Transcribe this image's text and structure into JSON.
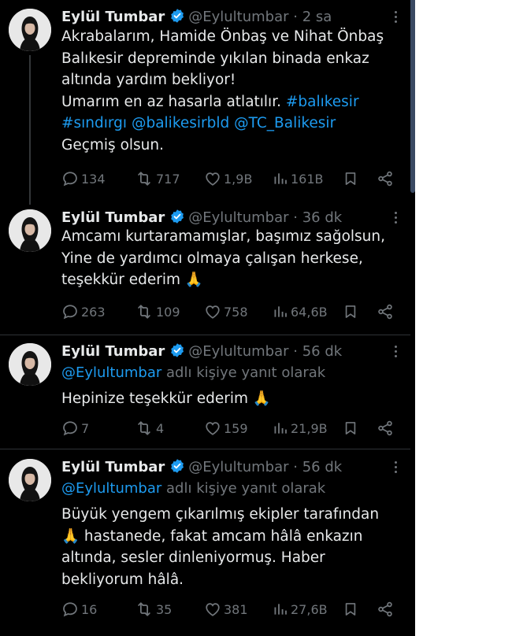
{
  "colors": {
    "background": "#000000",
    "text": "#e7e9ea",
    "secondary": "#71767b",
    "link": "#1d9bf0",
    "verified": "#1d9bf0",
    "divider": "#2f3336"
  },
  "tweets": [
    {
      "name": "Eylül Tumbar",
      "handle": "@Eylultumbar",
      "time": "· 2 sa",
      "reply_to": null,
      "lines": [
        [
          {
            "t": "Akrabalarım, Hamide Önbaş ve Nihat Önbaş"
          }
        ],
        [
          {
            "t": "Balıkesir depreminde yıkılan binada enkaz"
          }
        ],
        [
          {
            "t": "altında yardım bekliyor!"
          }
        ],
        [
          {
            "t": "Umarım en az hasarla atlatılır. "
          },
          {
            "t": "#balıkesir",
            "link": true
          }
        ],
        [
          {
            "t": "#sındırgı",
            "link": true
          },
          {
            "t": " "
          },
          {
            "t": "@balikesirbld",
            "link": true
          },
          {
            "t": " "
          },
          {
            "t": "@TC_Balikesir",
            "link": true
          }
        ],
        [
          {
            "t": "Geçmiş olsun."
          }
        ]
      ],
      "stats": {
        "replies": "134",
        "retweets": "717",
        "likes": "1,9B",
        "views": "161B"
      }
    },
    {
      "name": "Eylül Tumbar",
      "handle": "@Eylultumbar",
      "time": "· 36 dk",
      "reply_to": null,
      "lines": [
        [
          {
            "t": "Amcamı kurtaramamışlar, başımız sağolsun,"
          }
        ],
        [
          {
            "t": "Yine de yardımcı olmaya çalışan herkese,"
          }
        ],
        [
          {
            "t": "teşekkür ederim 🙏"
          }
        ]
      ],
      "stats": {
        "replies": "263",
        "retweets": "109",
        "likes": "758",
        "views": "64,6B"
      }
    },
    {
      "name": "Eylül Tumbar",
      "handle": "@Eylultumbar",
      "time": "· 56 dk",
      "reply_to": {
        "handle": "@Eylultumbar",
        "suffix": " adlı kişiye yanıt olarak"
      },
      "lines": [
        [
          {
            "t": "Hepinize teşekkür ederim 🙏"
          }
        ]
      ],
      "stats": {
        "replies": "7",
        "retweets": "4",
        "likes": "159",
        "views": "21,9B"
      }
    },
    {
      "name": "Eylül Tumbar",
      "handle": "@Eylultumbar",
      "time": "· 56 dk",
      "reply_to": {
        "handle": "@Eylultumbar",
        "suffix": " adlı kişiye yanıt olarak"
      },
      "lines": [
        [
          {
            "t": "Büyük yengem çıkarılmış ekipler tarafından"
          }
        ],
        [
          {
            "t": "🙏 hastanede, fakat amcam hâlâ enkazın"
          }
        ],
        [
          {
            "t": "altında, sesler dinleniyormuş. Haber"
          }
        ],
        [
          {
            "t": "bekliyorum hâlâ."
          }
        ]
      ],
      "stats": {
        "replies": "16",
        "retweets": "35",
        "likes": "381",
        "views": "27,6B"
      }
    }
  ]
}
